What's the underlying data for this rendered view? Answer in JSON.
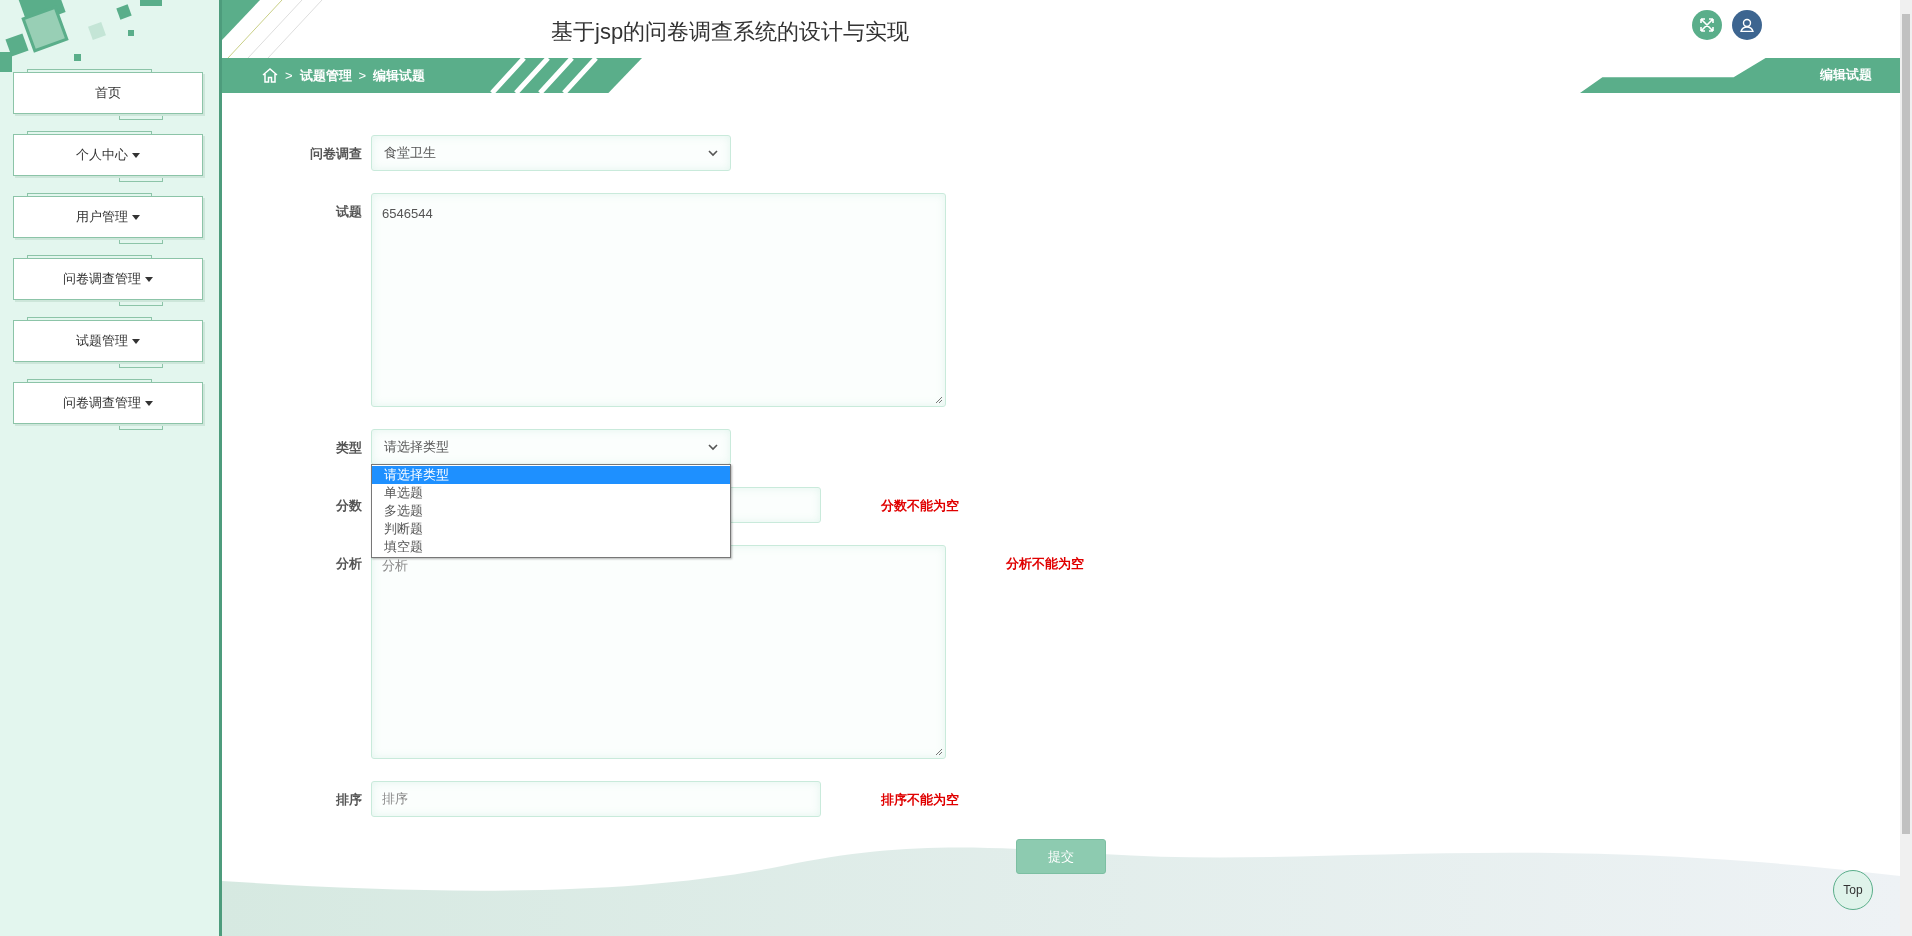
{
  "header": {
    "title": "基于jsp的问卷调查系统的设计与实现"
  },
  "breadcrumb": {
    "separator": ">",
    "items": [
      "试题管理",
      "编辑试题"
    ]
  },
  "page_tab": "编辑试题",
  "sidebar": {
    "items": [
      {
        "label": "首页",
        "dropdown": false
      },
      {
        "label": "个人中心",
        "dropdown": true
      },
      {
        "label": "用户管理",
        "dropdown": true
      },
      {
        "label": "问卷调查管理",
        "dropdown": true
      },
      {
        "label": "试题管理",
        "dropdown": true
      },
      {
        "label": "问卷调查管理",
        "dropdown": true
      }
    ]
  },
  "form": {
    "fields": [
      {
        "kind": "select",
        "label": "问卷调查",
        "value": "食堂卫生",
        "open": false
      },
      {
        "kind": "textarea",
        "label": "试题",
        "value": "6546544"
      },
      {
        "kind": "select",
        "label": "类型",
        "value": "请选择类型",
        "open": true,
        "options": [
          {
            "label": "请选择类型",
            "selected": true
          },
          {
            "label": "单选题",
            "selected": false
          },
          {
            "label": "多选题",
            "selected": false
          },
          {
            "label": "判断题",
            "selected": false
          },
          {
            "label": "填空题",
            "selected": false
          }
        ]
      },
      {
        "kind": "input",
        "label": "分数",
        "error": "分数不能为空"
      },
      {
        "kind": "textarea",
        "label": "分析",
        "placeholder": "分析",
        "error": "分析不能为空"
      },
      {
        "kind": "input",
        "label": "排序",
        "placeholder": "排序",
        "error": "排序不能为空"
      }
    ],
    "submit": "提交"
  },
  "top_button": "Top"
}
